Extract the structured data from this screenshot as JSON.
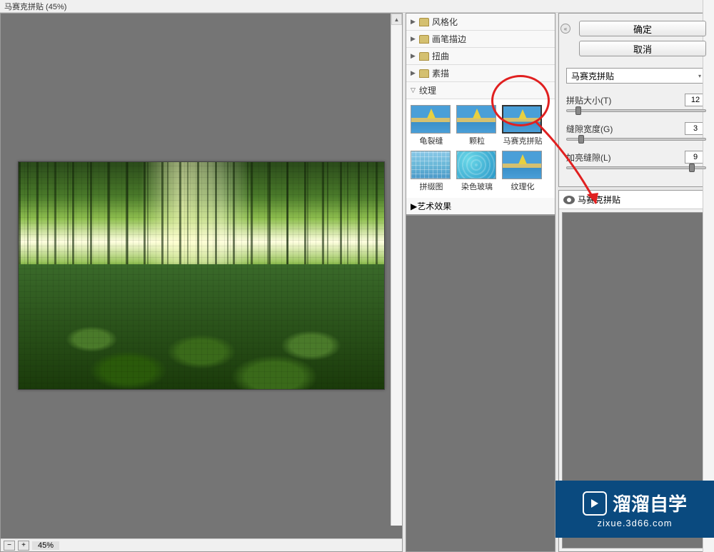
{
  "title": "马赛克拼贴 (45%)",
  "zoom": "45%",
  "categories": [
    {
      "label": "风格化",
      "expanded": false
    },
    {
      "label": "画笔描边",
      "expanded": false
    },
    {
      "label": "扭曲",
      "expanded": false
    },
    {
      "label": "素描",
      "expanded": false
    },
    {
      "label": "纹理",
      "expanded": true
    }
  ],
  "texture_filters": [
    {
      "label": "龟裂缝",
      "name": "craquelure"
    },
    {
      "label": "颗粒",
      "name": "grain"
    },
    {
      "label": "马赛克拼贴",
      "name": "mosaic-tiles",
      "selected": true
    },
    {
      "label": "拼缀图",
      "name": "patchwork"
    },
    {
      "label": "染色玻璃",
      "name": "stained-glass"
    },
    {
      "label": "纹理化",
      "name": "texturizer"
    }
  ],
  "artistic_category": "艺术效果",
  "buttons": {
    "ok": "确定",
    "cancel": "取消"
  },
  "filter_dropdown": "马赛克拼贴",
  "sliders": [
    {
      "label": "拼贴大小(T)",
      "value": "12",
      "pos": 6
    },
    {
      "label": "缝隙宽度(G)",
      "value": "3",
      "pos": 8
    },
    {
      "label": "加亮缝隙(L)",
      "value": "9",
      "pos": 88
    }
  ],
  "layer_tab": "马赛克拼贴",
  "watermark": {
    "brand": "溜溜自学",
    "url": "zixue.3d66.com"
  }
}
